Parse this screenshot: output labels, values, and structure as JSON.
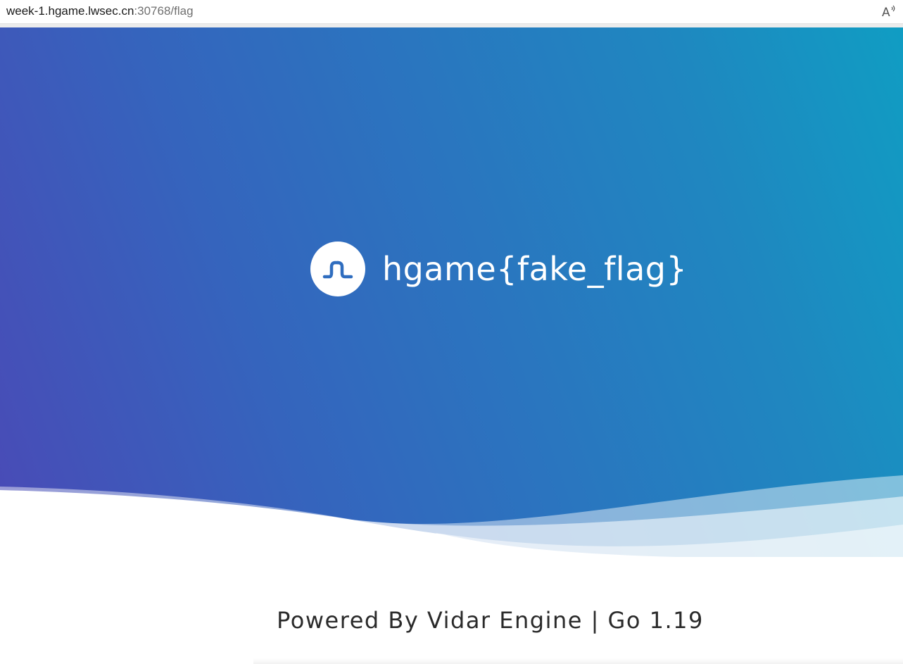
{
  "browser": {
    "url_host": "week-1.hgame.lwsec.cn",
    "url_rest": ":30768/flag",
    "read_aloud_icon": "read-aloud-icon"
  },
  "hero": {
    "logo_icon": "vidar-wave-logo-icon",
    "title": "hgame{fake_flag}"
  },
  "footer": {
    "text": "Powered By Vidar Engine | Go 1.19"
  },
  "colors": {
    "gradient_start": "#4a4ab6",
    "gradient_mid": "#2b74bf",
    "gradient_end": "#109dc3",
    "title_text": "#ffffff",
    "footer_text": "#2a2a2a"
  }
}
